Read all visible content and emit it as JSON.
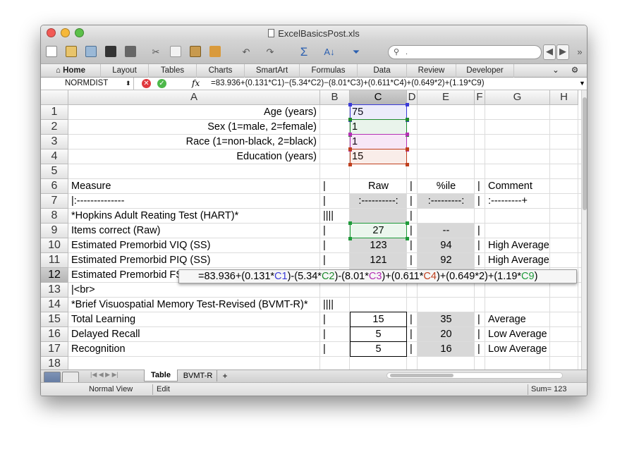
{
  "window": {
    "title": "ExcelBasicsPost.xls"
  },
  "ribbon": {
    "tabs": [
      "Home",
      "Layout",
      "Tables",
      "Charts",
      "SmartArt",
      "Formulas",
      "Data",
      "Review",
      "Developer"
    ]
  },
  "formula_bar": {
    "name_box": "NORMDIST",
    "fx": "fx",
    "formula": "=83.936+(0.131*C1)−(5.34*C2)−(8.01*C3)+(0.611*C4)+(0.649*2)+(1.19*C9)"
  },
  "search": {
    "placeholder": "."
  },
  "columns": [
    "A",
    "B",
    "C",
    "D",
    "E",
    "F",
    "G",
    "H"
  ],
  "rows": [
    "1",
    "2",
    "3",
    "4",
    "5",
    "6",
    "7",
    "8",
    "9",
    "10",
    "11",
    "12",
    "13",
    "14",
    "15",
    "16",
    "17",
    "18"
  ],
  "cells": {
    "a1": "Age (years)",
    "c1": "75",
    "a2": "Sex (1=male, 2=female)",
    "c2": "1",
    "a3": "Race (1=non-black, 2=black)",
    "c3": "1",
    "a4": "Education (years)",
    "c4": "15",
    "a6": "Measure",
    "b6": "|",
    "c6": "Raw",
    "d6": "|",
    "e6": "%ile",
    "f6": "|",
    "g6": "Comment",
    "a7": "|:--------------",
    "b7": "|",
    "c7": ":----------:",
    "d7": "|",
    "e7": ":---------:",
    "f7": "|",
    "g7": ":---------+",
    "a8": "*Hopkins Adult Reating Test (HART)*",
    "b8": "||||",
    "d8": "|",
    "a9": "Items correct (Raw)",
    "b9": "|",
    "c9": "27",
    "d9": "|",
    "e9": "--",
    "f9": "|",
    "a10": "Estimated Premorbid VIQ (SS)",
    "b10": "|",
    "c10": "123",
    "d10": "|",
    "e10": "94",
    "f10": "|",
    "g10": "High Average",
    "a11": "Estimated Premorbid PIQ (SS)",
    "b11": "|",
    "c11": "121",
    "d11": "|",
    "e11": "92",
    "f11": "|",
    "g11": "High Average",
    "a12": "Estimated Premorbid FSIQ (SS)",
    "a13": "|<br>",
    "a14": "*Brief Visuospatial Memory Test-Revised (BVMT-R)*",
    "b14": "||||",
    "a15": "Total Learning",
    "b15": "|",
    "c15": "15",
    "d15": "|",
    "e15": "35",
    "f15": "|",
    "g15": "Average",
    "a16": "Delayed Recall",
    "b16": "|",
    "c16": "5",
    "d16": "|",
    "e16": "20",
    "f16": "|",
    "g16": "Low Average",
    "a17": "Recognition",
    "b17": "|",
    "c17": "5",
    "d17": "|",
    "e17": "16",
    "f17": "|",
    "g17": "Low Average"
  },
  "tooltip": {
    "p1": "=83.936+(0.131*",
    "r1": "C1",
    "p2": ")-(5.34*",
    "r2": "C2",
    "p3": ")-(8.01*",
    "r3": "C3",
    "p4": ")+(0.611*",
    "r4": "C4",
    "p5": ")+(0.649*2)+(1.19*",
    "r5": "C9",
    "p6": ")"
  },
  "sheets": [
    "Table",
    "BVMT-R",
    "+"
  ],
  "status": {
    "view": "Normal View",
    "mode": "Edit",
    "sum": "Sum= 123"
  },
  "colors": {
    "c1": "#3a3ad8",
    "c2": "#1f8a2e",
    "c3": "#b530b5",
    "c4": "#c0401e",
    "c9": "#1f9a3a"
  }
}
